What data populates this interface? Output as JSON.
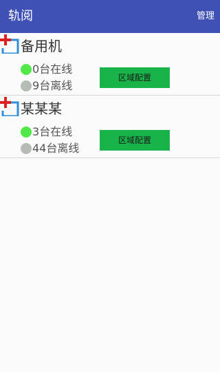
{
  "appbar": {
    "title": "轨阅",
    "action_label": "管理",
    "color": "#3f51b5"
  },
  "add_icon": "add-icon",
  "colors": {
    "online": "#52e84a",
    "offline": "#b4bcb4",
    "button": "#18b44a",
    "plus": "#e02020",
    "bracket": "#2f8fd8"
  },
  "groups": [
    {
      "name": "备用机",
      "online_count": "0",
      "online_label": "台在线",
      "offline_count": "9",
      "offline_label": "台离线",
      "button_label": "区域配置"
    },
    {
      "name": "某某某",
      "online_count": "3",
      "online_label": "台在线",
      "offline_count": "44",
      "offline_label": "台离线",
      "button_label": "区域配置"
    }
  ]
}
